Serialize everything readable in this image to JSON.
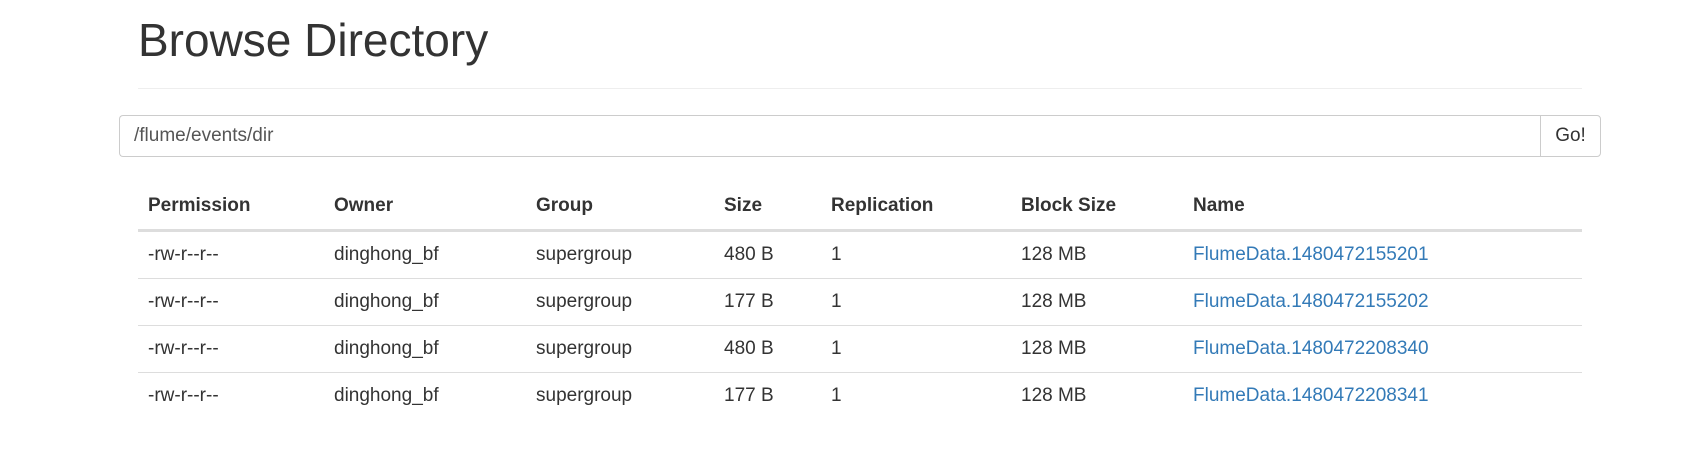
{
  "header": {
    "title": "Browse Directory"
  },
  "path_form": {
    "value": "/flume/events/dir",
    "go_label": "Go!"
  },
  "table": {
    "columns": [
      "Permission",
      "Owner",
      "Group",
      "Size",
      "Replication",
      "Block Size",
      "Name"
    ],
    "rows": [
      {
        "permission": "-rw-r--r--",
        "owner": "dinghong_bf",
        "group": "supergroup",
        "size": "480 B",
        "replication": "1",
        "block_size": "128 MB",
        "name": "FlumeData.1480472155201"
      },
      {
        "permission": "-rw-r--r--",
        "owner": "dinghong_bf",
        "group": "supergroup",
        "size": "177 B",
        "replication": "1",
        "block_size": "128 MB",
        "name": "FlumeData.1480472155202"
      },
      {
        "permission": "-rw-r--r--",
        "owner": "dinghong_bf",
        "group": "supergroup",
        "size": "480 B",
        "replication": "1",
        "block_size": "128 MB",
        "name": "FlumeData.1480472208340"
      },
      {
        "permission": "-rw-r--r--",
        "owner": "dinghong_bf",
        "group": "supergroup",
        "size": "177 B",
        "replication": "1",
        "block_size": "128 MB",
        "name": "FlumeData.1480472208341"
      }
    ]
  },
  "colors": {
    "link": "#337ab7",
    "text": "#333333",
    "border": "#dddddd"
  }
}
